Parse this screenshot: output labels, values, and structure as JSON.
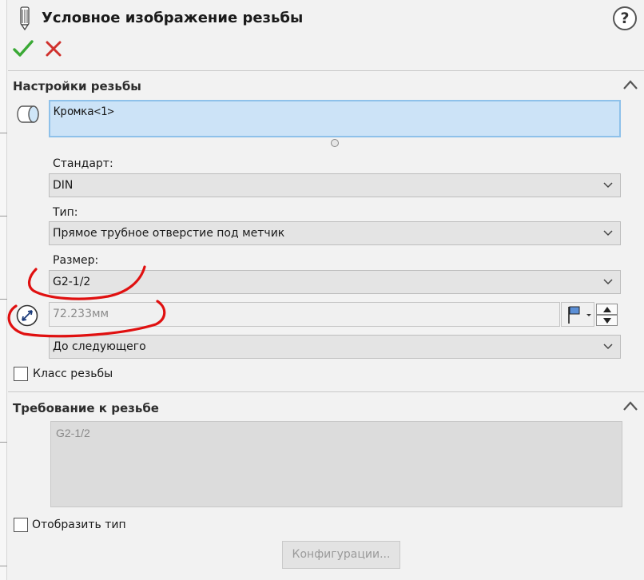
{
  "window": {
    "title": "Условное изображение резьбы",
    "help_label": "?"
  },
  "actions": {
    "ok_icon": "checkmark-icon",
    "cancel_icon": "close-icon"
  },
  "thread_settings": {
    "title": "Настройки резьбы",
    "edges": [
      "Кромка<1>"
    ],
    "standard": {
      "label": "Стандарт:",
      "value": "DIN"
    },
    "type": {
      "label": "Тип:",
      "value": "Прямое трубное отверстие под метчик"
    },
    "size": {
      "label": "Размер:",
      "value": "G2-1/2"
    },
    "diameter": {
      "value": "72.233мм"
    },
    "end_condition": {
      "value": "До следующего"
    },
    "thread_class": {
      "label": "Класс резьбы",
      "checked": false
    }
  },
  "thread_callout": {
    "title": "Требование к резьбе",
    "value": "G2-1/2",
    "show_type": {
      "label": "Отобразить тип",
      "checked": false
    },
    "config_button": "Конфигурации..."
  },
  "colors": {
    "accent_blue": "#cce3f7",
    "ok_green": "#3aa935",
    "cancel_red": "#d0312d",
    "annotation_red": "#e01010"
  }
}
